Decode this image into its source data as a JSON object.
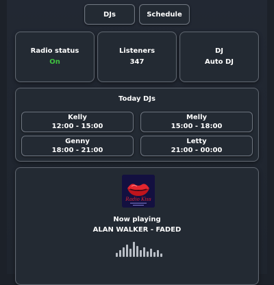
{
  "tabs": {
    "djs": "DJs",
    "schedule": "Schedule"
  },
  "stats": {
    "radio_status": {
      "label": "Radio status",
      "value": "On",
      "value_color": "#3fc33f"
    },
    "listeners": {
      "label": "Listeners",
      "value": "347"
    },
    "dj": {
      "label": "DJ",
      "value": "Auto DJ"
    }
  },
  "today": {
    "title": "Today DJs",
    "slots": [
      {
        "name": "Kelly",
        "time": "12:00 - 15:00"
      },
      {
        "name": "Melly",
        "time": "15:00 - 18:00"
      },
      {
        "name": "Genny",
        "time": "18:00 - 21:00"
      },
      {
        "name": "Letty",
        "time": "21:00 - 00:00"
      }
    ]
  },
  "player": {
    "logo_text": "Radio Kiss",
    "now_playing_label": "Now playing",
    "track": "ALAN WALKER - FADED",
    "icon": "equalizer-icon"
  },
  "colors": {
    "background": "#1c2129",
    "card": "#232a33",
    "border": "#5f6670",
    "accent_on": "#3fc33f"
  }
}
